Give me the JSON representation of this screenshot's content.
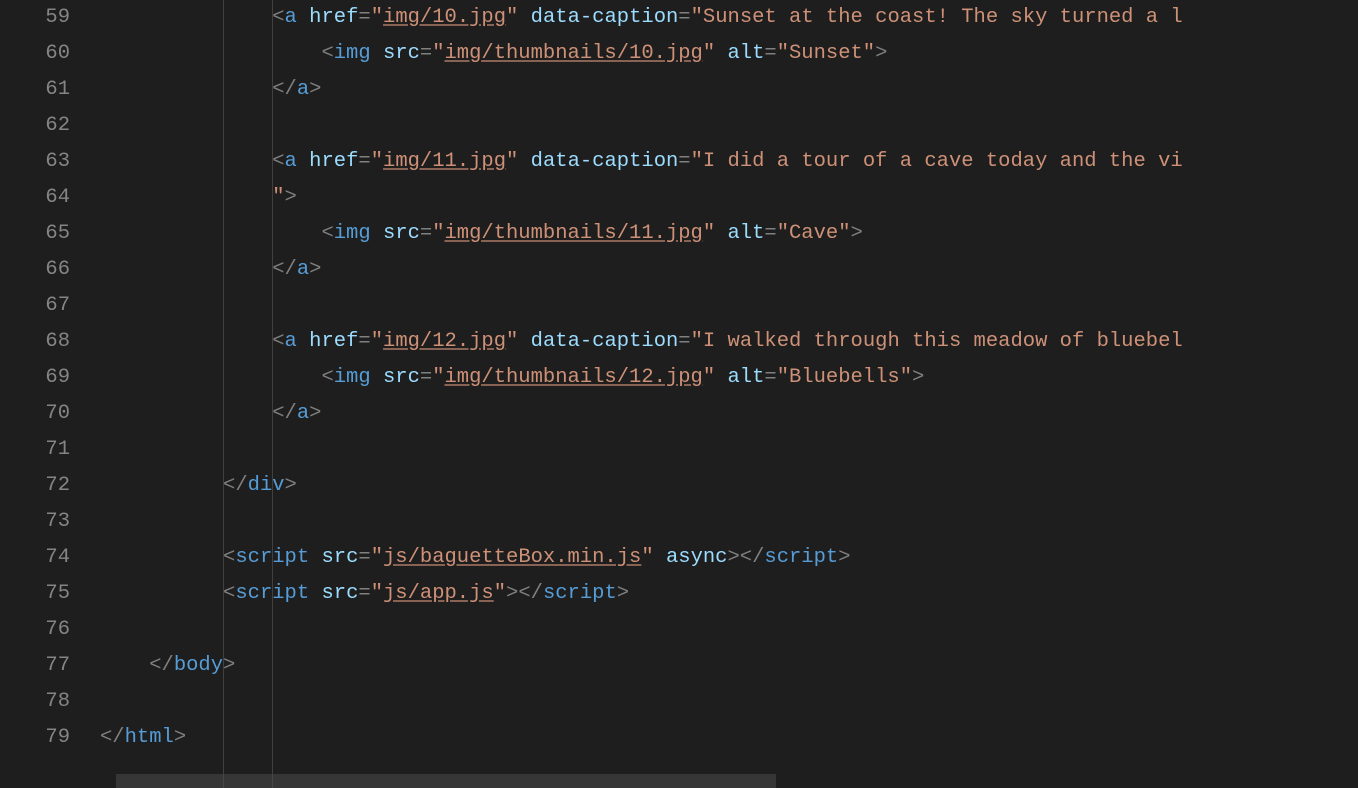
{
  "editor": {
    "startLine": 59,
    "endLine": 79,
    "lineNumbers": [
      "59",
      "60",
      "61",
      "62",
      "63",
      "64",
      "65",
      "66",
      "67",
      "68",
      "69",
      "70",
      "71",
      "72",
      "73",
      "74",
      "75",
      "76",
      "77",
      "78",
      "79"
    ],
    "lines": [
      {
        "indent": 14,
        "t": [
          {
            "c": "p",
            "v": "<"
          },
          {
            "c": "tn",
            "v": "a"
          },
          {
            "c": "",
            "v": " "
          },
          {
            "c": "an",
            "v": "href"
          },
          {
            "c": "p",
            "v": "="
          },
          {
            "c": "av",
            "v": "\""
          },
          {
            "c": "av ul",
            "v": "img/10.jpg"
          },
          {
            "c": "av",
            "v": "\""
          },
          {
            "c": "",
            "v": " "
          },
          {
            "c": "an",
            "v": "data-caption"
          },
          {
            "c": "p",
            "v": "="
          },
          {
            "c": "av",
            "v": "\"Sunset at the coast! The sky turned a l"
          }
        ]
      },
      {
        "indent": 18,
        "t": [
          {
            "c": "p",
            "v": "<"
          },
          {
            "c": "tn",
            "v": "img"
          },
          {
            "c": "",
            "v": " "
          },
          {
            "c": "an",
            "v": "src"
          },
          {
            "c": "p",
            "v": "="
          },
          {
            "c": "av",
            "v": "\""
          },
          {
            "c": "av ul",
            "v": "img/thumbnails/10.jpg"
          },
          {
            "c": "av",
            "v": "\""
          },
          {
            "c": "",
            "v": " "
          },
          {
            "c": "an",
            "v": "alt"
          },
          {
            "c": "p",
            "v": "="
          },
          {
            "c": "av",
            "v": "\"Sunset\""
          },
          {
            "c": "p",
            "v": ">"
          }
        ]
      },
      {
        "indent": 14,
        "t": [
          {
            "c": "p",
            "v": "</"
          },
          {
            "c": "tn",
            "v": "a"
          },
          {
            "c": "p",
            "v": ">"
          }
        ]
      },
      {
        "indent": 0,
        "t": []
      },
      {
        "indent": 14,
        "t": [
          {
            "c": "p",
            "v": "<"
          },
          {
            "c": "tn",
            "v": "a"
          },
          {
            "c": "",
            "v": " "
          },
          {
            "c": "an",
            "v": "href"
          },
          {
            "c": "p",
            "v": "="
          },
          {
            "c": "av",
            "v": "\""
          },
          {
            "c": "av ul",
            "v": "img/11.jpg"
          },
          {
            "c": "av",
            "v": "\""
          },
          {
            "c": "",
            "v": " "
          },
          {
            "c": "an",
            "v": "data-caption"
          },
          {
            "c": "p",
            "v": "="
          },
          {
            "c": "av",
            "v": "\"I did a tour of a cave today and the vi"
          }
        ]
      },
      {
        "indent": 14,
        "t": [
          {
            "c": "av",
            "v": "\""
          },
          {
            "c": "p",
            "v": ">"
          }
        ]
      },
      {
        "indent": 18,
        "t": [
          {
            "c": "p",
            "v": "<"
          },
          {
            "c": "tn",
            "v": "img"
          },
          {
            "c": "",
            "v": " "
          },
          {
            "c": "an",
            "v": "src"
          },
          {
            "c": "p",
            "v": "="
          },
          {
            "c": "av",
            "v": "\""
          },
          {
            "c": "av ul",
            "v": "img/thumbnails/11.jpg"
          },
          {
            "c": "av",
            "v": "\""
          },
          {
            "c": "",
            "v": " "
          },
          {
            "c": "an",
            "v": "alt"
          },
          {
            "c": "p",
            "v": "="
          },
          {
            "c": "av",
            "v": "\"Cave\""
          },
          {
            "c": "p",
            "v": ">"
          }
        ]
      },
      {
        "indent": 14,
        "t": [
          {
            "c": "p",
            "v": "</"
          },
          {
            "c": "tn",
            "v": "a"
          },
          {
            "c": "p",
            "v": ">"
          }
        ]
      },
      {
        "indent": 0,
        "t": []
      },
      {
        "indent": 14,
        "t": [
          {
            "c": "p",
            "v": "<"
          },
          {
            "c": "tn",
            "v": "a"
          },
          {
            "c": "",
            "v": " "
          },
          {
            "c": "an",
            "v": "href"
          },
          {
            "c": "p",
            "v": "="
          },
          {
            "c": "av",
            "v": "\""
          },
          {
            "c": "av ul",
            "v": "img/12.jpg"
          },
          {
            "c": "av",
            "v": "\""
          },
          {
            "c": "",
            "v": " "
          },
          {
            "c": "an",
            "v": "data-caption"
          },
          {
            "c": "p",
            "v": "="
          },
          {
            "c": "av",
            "v": "\"I walked through this meadow of bluebel"
          }
        ]
      },
      {
        "indent": 18,
        "t": [
          {
            "c": "p",
            "v": "<"
          },
          {
            "c": "tn",
            "v": "img"
          },
          {
            "c": "",
            "v": " "
          },
          {
            "c": "an",
            "v": "src"
          },
          {
            "c": "p",
            "v": "="
          },
          {
            "c": "av",
            "v": "\""
          },
          {
            "c": "av ul",
            "v": "img/thumbnails/12.jpg"
          },
          {
            "c": "av",
            "v": "\""
          },
          {
            "c": "",
            "v": " "
          },
          {
            "c": "an",
            "v": "alt"
          },
          {
            "c": "p",
            "v": "="
          },
          {
            "c": "av",
            "v": "\"Bluebells\""
          },
          {
            "c": "p",
            "v": ">"
          }
        ]
      },
      {
        "indent": 14,
        "t": [
          {
            "c": "p",
            "v": "</"
          },
          {
            "c": "tn",
            "v": "a"
          },
          {
            "c": "p",
            "v": ">"
          }
        ]
      },
      {
        "indent": 0,
        "t": []
      },
      {
        "indent": 10,
        "t": [
          {
            "c": "p",
            "v": "</"
          },
          {
            "c": "tn",
            "v": "div"
          },
          {
            "c": "p",
            "v": ">"
          }
        ]
      },
      {
        "indent": 0,
        "t": []
      },
      {
        "indent": 10,
        "t": [
          {
            "c": "p",
            "v": "<"
          },
          {
            "c": "tn",
            "v": "script"
          },
          {
            "c": "",
            "v": " "
          },
          {
            "c": "an",
            "v": "src"
          },
          {
            "c": "p",
            "v": "="
          },
          {
            "c": "av",
            "v": "\""
          },
          {
            "c": "av ul",
            "v": "js/baguetteBox.min.js"
          },
          {
            "c": "av",
            "v": "\""
          },
          {
            "c": "",
            "v": " "
          },
          {
            "c": "an",
            "v": "async"
          },
          {
            "c": "p",
            "v": ">"
          },
          {
            "c": "p",
            "v": "</"
          },
          {
            "c": "tn",
            "v": "script"
          },
          {
            "c": "p",
            "v": ">"
          }
        ]
      },
      {
        "indent": 10,
        "t": [
          {
            "c": "p",
            "v": "<"
          },
          {
            "c": "tn",
            "v": "script"
          },
          {
            "c": "",
            "v": " "
          },
          {
            "c": "an",
            "v": "src"
          },
          {
            "c": "p",
            "v": "="
          },
          {
            "c": "av",
            "v": "\""
          },
          {
            "c": "av ul",
            "v": "js/app.js"
          },
          {
            "c": "av",
            "v": "\""
          },
          {
            "c": "p",
            "v": ">"
          },
          {
            "c": "p",
            "v": "</"
          },
          {
            "c": "tn",
            "v": "script"
          },
          {
            "c": "p",
            "v": ">"
          }
        ]
      },
      {
        "indent": 0,
        "t": []
      },
      {
        "indent": 4,
        "t": [
          {
            "c": "p",
            "v": "</"
          },
          {
            "c": "tn",
            "v": "body"
          },
          {
            "c": "p",
            "v": ">"
          }
        ]
      },
      {
        "indent": 0,
        "t": []
      },
      {
        "indent": 0,
        "t": [
          {
            "c": "p",
            "v": "</"
          },
          {
            "c": "tn",
            "v": "html"
          },
          {
            "c": "p",
            "v": ">"
          }
        ]
      }
    ],
    "indentGuides": [
      10,
      14
    ]
  }
}
